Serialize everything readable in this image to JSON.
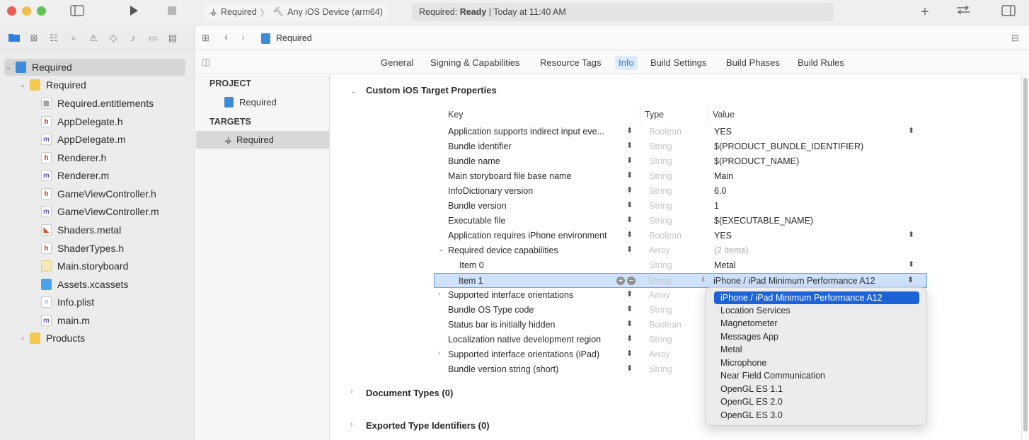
{
  "toolbar": {
    "scheme_name": "Required",
    "device_name": "Any iOS Device (arm64)",
    "status_prefix": "Required: ",
    "status_state": "Ready",
    "status_time": "Today at 11:40 AM"
  },
  "navigator": {
    "items": [
      {
        "label": "Required",
        "icon": "project-icon"
      },
      {
        "label": "Required",
        "icon": "folder-icon"
      },
      {
        "label": "Required.entitlements",
        "icon": "entitlements-file-icon"
      },
      {
        "label": "AppDelegate.h",
        "icon": "header-file-icon"
      },
      {
        "label": "AppDelegate.m",
        "icon": "objc-file-icon"
      },
      {
        "label": "Renderer.h",
        "icon": "header-file-icon"
      },
      {
        "label": "Renderer.m",
        "icon": "objc-file-icon"
      },
      {
        "label": "GameViewController.h",
        "icon": "header-file-icon"
      },
      {
        "label": "GameViewController.m",
        "icon": "objc-file-icon"
      },
      {
        "label": "Shaders.metal",
        "icon": "metal-file-icon"
      },
      {
        "label": "ShaderTypes.h",
        "icon": "header-file-icon"
      },
      {
        "label": "Main.storyboard",
        "icon": "storyboard-file-icon"
      },
      {
        "label": "Assets.xcassets",
        "icon": "assets-folder-icon"
      },
      {
        "label": "Info.plist",
        "icon": "plist-file-icon"
      },
      {
        "label": "main.m",
        "icon": "objc-file-icon"
      },
      {
        "label": "Products",
        "icon": "folder-icon"
      }
    ]
  },
  "jumpbar": {
    "file": "Required"
  },
  "tabs": [
    "General",
    "Signing & Capabilities",
    "Resource Tags",
    "Info",
    "Build Settings",
    "Build Phases",
    "Build Rules"
  ],
  "target_list": {
    "project_header": "PROJECT",
    "project_item": "Required",
    "targets_header": "TARGETS",
    "target_item": "Required"
  },
  "info": {
    "section_title": "Custom iOS Target Properties",
    "col_key": "Key",
    "col_type": "Type",
    "col_value": "Value",
    "rows": [
      {
        "key": "Application supports indirect input eve...",
        "type": "Boolean",
        "value": "YES"
      },
      {
        "key": "Bundle identifier",
        "type": "String",
        "value": "$(PRODUCT_BUNDLE_IDENTIFIER)"
      },
      {
        "key": "Bundle name",
        "type": "String",
        "value": "$(PRODUCT_NAME)"
      },
      {
        "key": "Main storyboard file base name",
        "type": "String",
        "value": "Main"
      },
      {
        "key": "InfoDictionary version",
        "type": "String",
        "value": "6.0"
      },
      {
        "key": "Bundle version",
        "type": "String",
        "value": "1"
      },
      {
        "key": "Executable file",
        "type": "String",
        "value": "$(EXECUTABLE_NAME)"
      },
      {
        "key": "Application requires iPhone environment",
        "type": "Boolean",
        "value": "YES"
      },
      {
        "key": "Required device capabilities",
        "type": "Array",
        "value": "(2 items)"
      },
      {
        "key": "Item 0",
        "type": "String",
        "value": "Metal"
      },
      {
        "key": "Item 1",
        "type": "String",
        "value": "iPhone / iPad Minimum Performance A12"
      },
      {
        "key": "Supported interface orientations",
        "type": "Array",
        "value": ""
      },
      {
        "key": "Bundle OS Type code",
        "type": "String",
        "value": ""
      },
      {
        "key": "Status bar is initially hidden",
        "type": "Boolean",
        "value": ""
      },
      {
        "key": "Localization native development region",
        "type": "String",
        "value": ""
      },
      {
        "key": "Supported interface orientations (iPad)",
        "type": "Array",
        "value": ""
      },
      {
        "key": "Bundle version string (short)",
        "type": "String",
        "value": ""
      }
    ],
    "document_types": "Document Types (0)",
    "exported_types": "Exported Type Identifiers (0)"
  },
  "popup": {
    "options": [
      "iPhone / iPad Minimum Performance A12",
      "Location Services",
      "Magnetometer",
      "Messages App",
      "Metal",
      "Microphone",
      "Near Field Communication",
      "OpenGL ES 1.1",
      "OpenGL ES 2.0",
      "OpenGL ES 3.0"
    ]
  },
  "colors": {
    "accent": "#1d63d8",
    "selection": "#cfe2fb",
    "active_tab": "#2a7de1"
  }
}
